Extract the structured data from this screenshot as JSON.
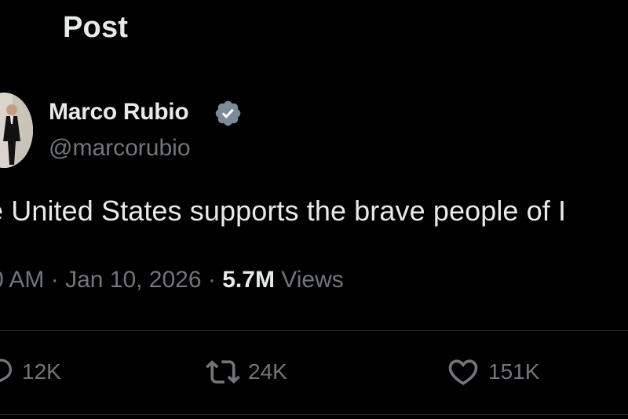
{
  "header": {
    "title": "Post"
  },
  "post": {
    "author_name": "Marco Rubio",
    "author_handle": "@marcorubio",
    "text": "e United States supports the brave people of I",
    "time": "0 AM",
    "date": "Jan 10, 2026",
    "views_count": "5.7M",
    "views_label": "Views",
    "separator": "·"
  },
  "actions": {
    "reply_count": "12K",
    "retweet_count": "24K",
    "like_count": "151K"
  },
  "icons": {
    "verified": "verified-badge-icon",
    "reply": "reply-icon",
    "retweet": "retweet-icon",
    "like": "heart-icon"
  },
  "colors": {
    "background": "#000000",
    "text_primary": "#e7e9ea",
    "text_secondary": "#71767b",
    "verified_badge": "#7a8a99",
    "divider": "#2f3336"
  }
}
